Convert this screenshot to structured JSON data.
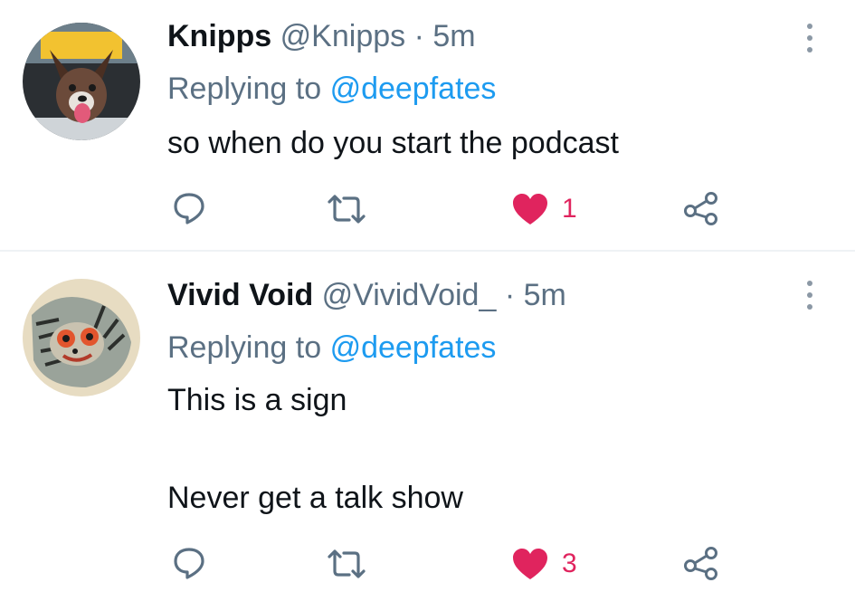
{
  "tweets": [
    {
      "name": "Knipps",
      "handle": "@Knipps",
      "time": "· 5m",
      "replying_prefix": "Replying to",
      "replying_to": "@deepfates",
      "lines": [
        "so when do you start the podcast"
      ],
      "likes": "1",
      "avatar_icon": "dog-avatar"
    },
    {
      "name": "Vivid Void",
      "handle": "@VividVoid_",
      "time": "· 5m",
      "replying_prefix": "Replying to",
      "replying_to": "@deepfates",
      "lines": [
        "This is a sign",
        "",
        "Never get a talk show"
      ],
      "likes": "3",
      "avatar_icon": "tiger-painting-avatar"
    }
  ],
  "colors": {
    "accent": "#1d9bf0",
    "like": "#e0245e",
    "muted": "#5b7083",
    "text": "#0f1419"
  },
  "icons": [
    "reply-icon",
    "retweet-icon",
    "heart-icon",
    "share-icon",
    "more-icon"
  ]
}
